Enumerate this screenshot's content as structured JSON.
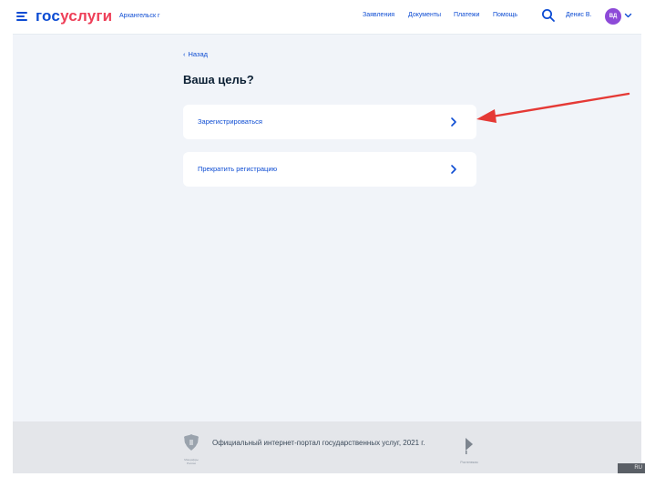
{
  "header": {
    "logo_part1": "гос",
    "logo_part2": "услуги",
    "city": "Архангельск г",
    "nav": [
      "Заявления",
      "Документы",
      "Платежи",
      "Помощь"
    ],
    "user_name": "Денис В.",
    "avatar_initials": "ВД"
  },
  "main": {
    "back_label": "Назад",
    "title": "Ваша цель?",
    "options": [
      {
        "label": "Зарегистрироваться"
      },
      {
        "label": "Прекратить регистрацию"
      }
    ]
  },
  "footer": {
    "text": "Официальный интернет-портал государственных услуг, 2021 г.",
    "emblem_caption": "Минцифры России",
    "rt_caption": "Ростелеком"
  },
  "lang_badge": "RU",
  "colors": {
    "accent": "#0d4cd3",
    "brand_red": "#ee3f58",
    "background": "#f1f4f9",
    "annotation_arrow": "#e53935"
  },
  "icons": [
    "menu-icon",
    "search-icon",
    "chevron-down-icon",
    "chevron-right-icon",
    "back-arrow-icon",
    "emblem-icon",
    "rostelecom-logo-icon"
  ]
}
